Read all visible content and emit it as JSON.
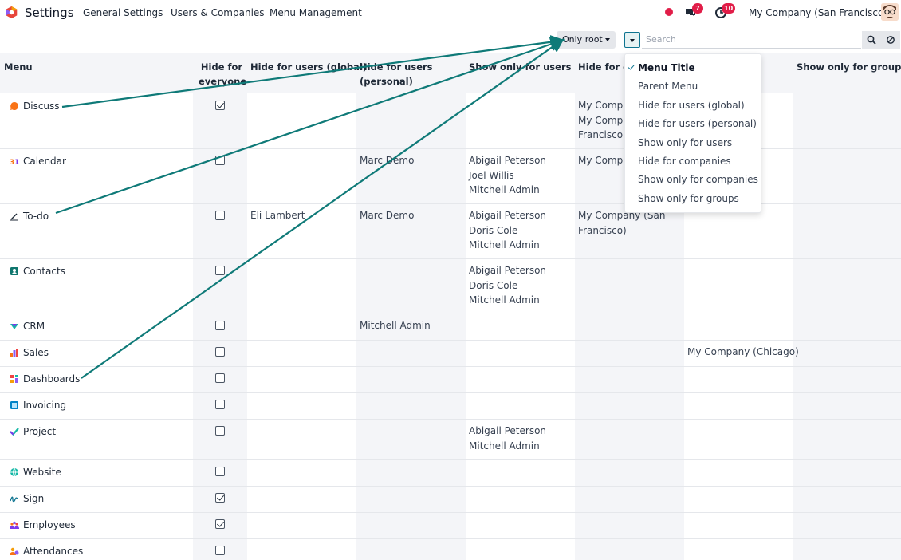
{
  "navbar": {
    "app_name": "Settings",
    "links": [
      "General Settings",
      "Users & Companies",
      "Menu Management"
    ],
    "messages_count": "7",
    "activities_count": "10",
    "company": "My Company (San Francisco)"
  },
  "controls": {
    "filter_label": "Only root",
    "search_placeholder": "Search"
  },
  "table": {
    "headers": {
      "menu": "Menu",
      "hide_everyone": "Hide for\neveryone",
      "hide_users_global": "Hide for users (global)",
      "hide_users_personal": "Hide for users\n(personal)",
      "show_users": "Show only for users",
      "hide_companies": "Hide for c",
      "show_groups": "Show only for groups"
    },
    "rows": [
      {
        "menu": "Discuss",
        "icon": "discuss-icon",
        "hide_everyone": true,
        "hide_global": "",
        "hide_personal": "",
        "show_users": "",
        "hide_companies": "My Compa\nMy Compa\nFrancisco)",
        "show_companies": ""
      },
      {
        "menu": "Calendar",
        "icon": "calendar-icon",
        "hide_everyone": false,
        "hide_global": "",
        "hide_personal": "Marc Demo",
        "show_users": "Abigail Peterson\nJoel Willis\nMitchell Admin",
        "hide_companies": "My Compa",
        "show_companies": ""
      },
      {
        "menu": "To-do",
        "icon": "todo-icon",
        "hide_everyone": false,
        "hide_global": "Eli Lambert",
        "hide_personal": "Marc Demo",
        "show_users": "Abigail Peterson\nDoris Cole\nMitchell Admin",
        "hide_companies": "My Company (San\nFrancisco)",
        "show_companies": ""
      },
      {
        "menu": "Contacts",
        "icon": "contacts-icon",
        "hide_everyone": false,
        "hide_global": "",
        "hide_personal": "",
        "show_users": "Abigail Peterson\nDoris Cole\nMitchell Admin",
        "hide_companies": "",
        "show_companies": ""
      },
      {
        "menu": "CRM",
        "icon": "crm-icon",
        "hide_everyone": false,
        "hide_global": "",
        "hide_personal": "Mitchell Admin",
        "show_users": "",
        "hide_companies": "",
        "show_companies": ""
      },
      {
        "menu": "Sales",
        "icon": "sales-icon",
        "hide_everyone": false,
        "hide_global": "",
        "hide_personal": "",
        "show_users": "",
        "hide_companies": "",
        "show_companies": "My Company (Chicago)"
      },
      {
        "menu": "Dashboards",
        "icon": "dashboards-icon",
        "hide_everyone": false,
        "hide_global": "",
        "hide_personal": "",
        "show_users": "",
        "hide_companies": "",
        "show_companies": ""
      },
      {
        "menu": "Invoicing",
        "icon": "invoicing-icon",
        "hide_everyone": false,
        "hide_global": "",
        "hide_personal": "",
        "show_users": "",
        "hide_companies": "",
        "show_companies": ""
      },
      {
        "menu": "Project",
        "icon": "project-icon",
        "hide_everyone": false,
        "hide_global": "",
        "hide_personal": "",
        "show_users": "Abigail Peterson\nMitchell Admin",
        "hide_companies": "",
        "show_companies": ""
      },
      {
        "menu": "Website",
        "icon": "website-icon",
        "hide_everyone": false,
        "hide_global": "",
        "hide_personal": "",
        "show_users": "",
        "hide_companies": "",
        "show_companies": ""
      },
      {
        "menu": "Sign",
        "icon": "sign-icon",
        "hide_everyone": true,
        "hide_global": "",
        "hide_personal": "",
        "show_users": "",
        "hide_companies": "",
        "show_companies": ""
      },
      {
        "menu": "Employees",
        "icon": "employees-icon",
        "hide_everyone": true,
        "hide_global": "",
        "hide_personal": "",
        "show_users": "",
        "hide_companies": "",
        "show_companies": ""
      },
      {
        "menu": "Attendances",
        "icon": "attendances-icon",
        "hide_everyone": false,
        "hide_global": "",
        "hide_personal": "",
        "show_users": "",
        "hide_companies": "",
        "show_companies": ""
      }
    ]
  },
  "column_dropdown": {
    "items": [
      {
        "label": "Menu Title",
        "selected": true
      },
      {
        "label": "Parent Menu",
        "selected": false
      },
      {
        "label": "Hide for users (global)",
        "selected": false
      },
      {
        "label": "Hide for users (personal)",
        "selected": false
      },
      {
        "label": "Show only for users",
        "selected": false
      },
      {
        "label": "Hide for companies",
        "selected": false
      },
      {
        "label": "Show only for companies",
        "selected": false
      },
      {
        "label": "Show only for groups",
        "selected": false
      }
    ]
  },
  "colors": {
    "accent": "#0e7490",
    "arrow": "#0f7a78",
    "badge": "#e11d48",
    "column_shade": "#f4f5f8"
  }
}
